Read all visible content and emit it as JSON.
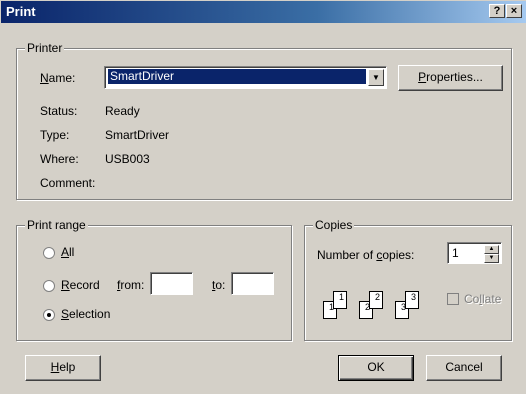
{
  "window": {
    "title": "Print",
    "help_glyph": "?",
    "close_glyph": "×"
  },
  "printer": {
    "legend": "Printer",
    "name_label_pre": "",
    "name_label_u": "N",
    "name_label_post": "ame:",
    "name_value": "SmartDriver",
    "properties_u": "P",
    "properties_post": "roperties...",
    "status_label": "Status:",
    "status_value": "Ready",
    "type_label": "Type:",
    "type_value": "SmartDriver",
    "where_label": "Where:",
    "where_value": "USB003",
    "comment_label": "Comment:"
  },
  "range": {
    "legend": "Print range",
    "all_u": "A",
    "all_post": "ll",
    "record_u": "R",
    "record_post": "ecord",
    "from_pre": "",
    "from_u": "f",
    "from_post": "rom:",
    "to_u": "t",
    "to_post": "o:",
    "selection_u": "S",
    "selection_post": "election",
    "selected": "selection"
  },
  "copies": {
    "legend": "Copies",
    "number_pre": "Number of ",
    "number_u": "c",
    "number_post": "opies:",
    "count": "1",
    "collate_pre": "Co",
    "collate_u": "l",
    "collate_post": "late",
    "pages": [
      "1",
      "1",
      "2",
      "2",
      "3",
      "3"
    ]
  },
  "buttons": {
    "help_u": "H",
    "help_post": "elp",
    "ok": "OK",
    "cancel": "Cancel"
  }
}
